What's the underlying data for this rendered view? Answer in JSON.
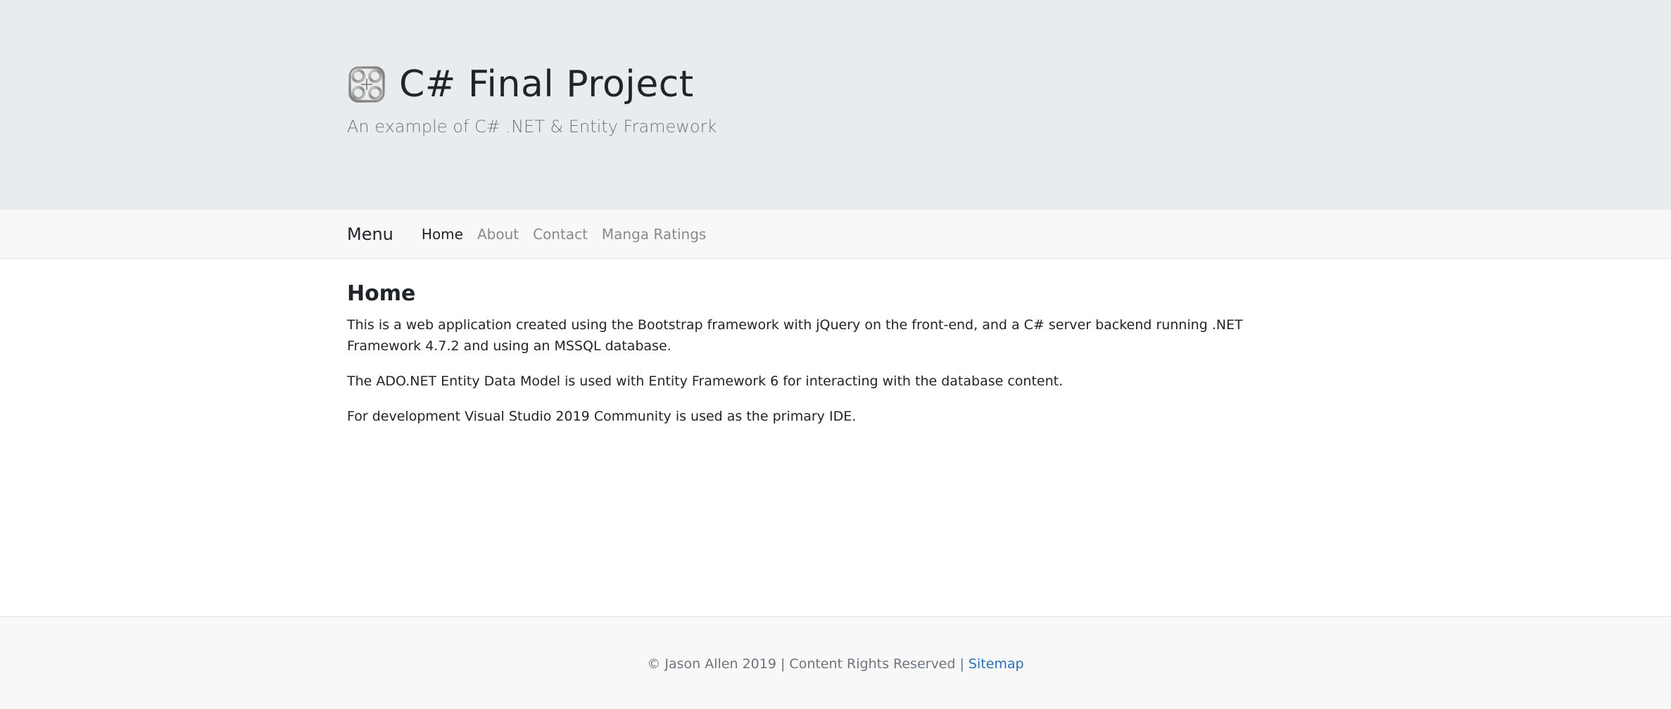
{
  "header": {
    "logo_icon": "chain-cross-icon",
    "title": "C# Final Project",
    "subtitle": "An example of C# .NET & Entity Framework"
  },
  "navbar": {
    "brand": "Menu",
    "links": [
      {
        "label": "Home",
        "active": true
      },
      {
        "label": "About",
        "active": false
      },
      {
        "label": "Contact",
        "active": false
      },
      {
        "label": "Manga Ratings",
        "active": false
      }
    ]
  },
  "main": {
    "heading": "Home",
    "paragraphs": [
      "This is a web application created using the Bootstrap framework with jQuery on the front-end, and a C# server backend running .NET Framework 4.7.2 and using an MSSQL database.",
      "The ADO.NET Entity Data Model is used with Entity Framework 6 for interacting with the database content.",
      "For development Visual Studio 2019 Community is used as the primary IDE."
    ]
  },
  "footer": {
    "text": "© Jason Allen 2019 | Content Rights Reserved | ",
    "link": "Sitemap"
  },
  "colors": {
    "jumbotron_bg": "#e9ecef",
    "navbar_bg": "#f8f8f8",
    "footer_link": "#2a6fb5"
  }
}
